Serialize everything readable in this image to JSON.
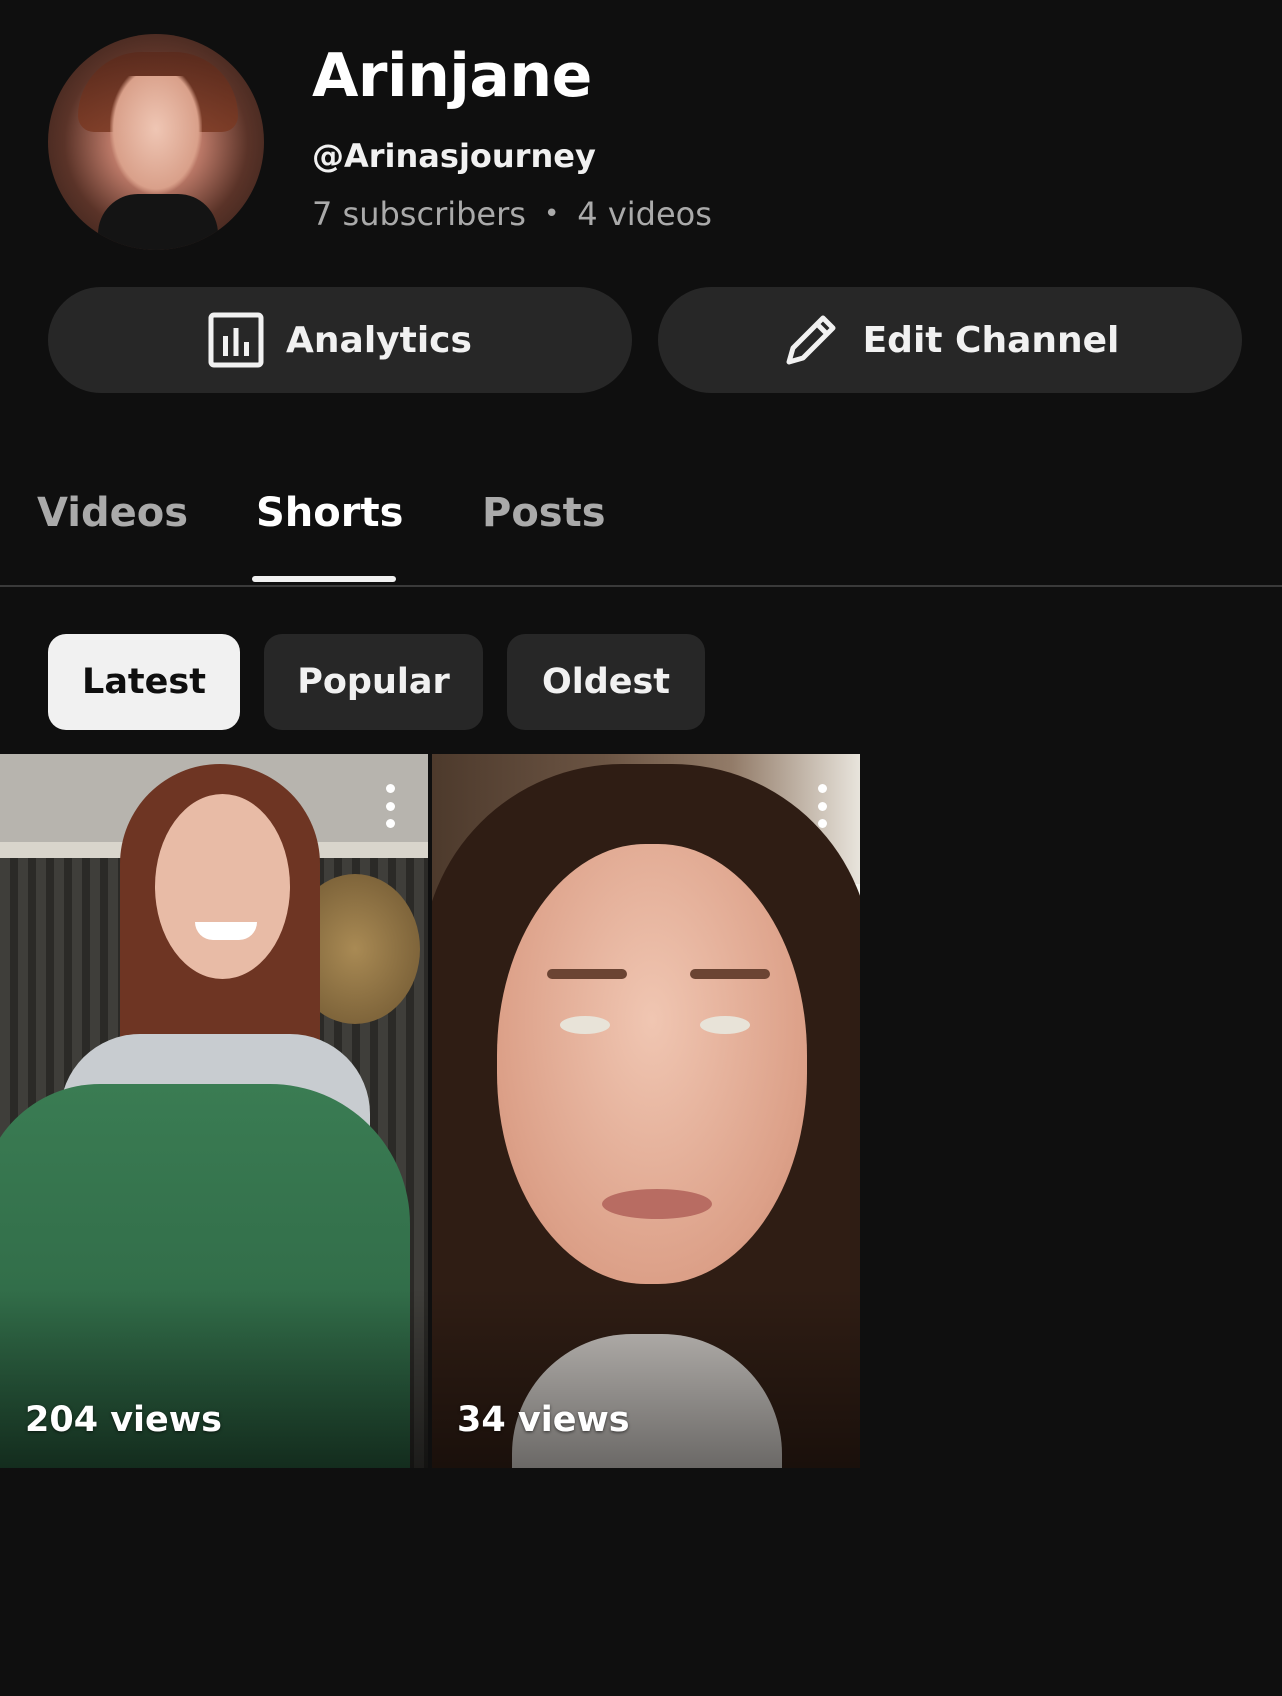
{
  "channel": {
    "name": "Arinjane",
    "handle": "@Arinasjourney",
    "subscribers": "7 subscribers",
    "separator": "•",
    "videos": "4 videos"
  },
  "actions": {
    "analytics_label": "Analytics",
    "edit_label": "Edit Channel"
  },
  "tabs": [
    {
      "label": "Videos",
      "active": false
    },
    {
      "label": "Shorts",
      "active": true
    },
    {
      "label": "Posts",
      "active": false
    }
  ],
  "filters": [
    {
      "label": "Latest",
      "selected": true
    },
    {
      "label": "Popular",
      "selected": false
    },
    {
      "label": "Oldest",
      "selected": false
    }
  ],
  "shorts": [
    {
      "views": "204 views"
    },
    {
      "views": "34 views"
    }
  ],
  "colors": {
    "background": "#0f0f0f",
    "button_bg": "#272727",
    "selected_chip_bg": "#f1f1f1",
    "text_primary": "#f1f1f1",
    "text_secondary": "#aaaaaa"
  },
  "icons": {
    "analytics": "bar-chart-icon",
    "edit": "pencil-icon",
    "more": "kebab-menu-icon"
  }
}
